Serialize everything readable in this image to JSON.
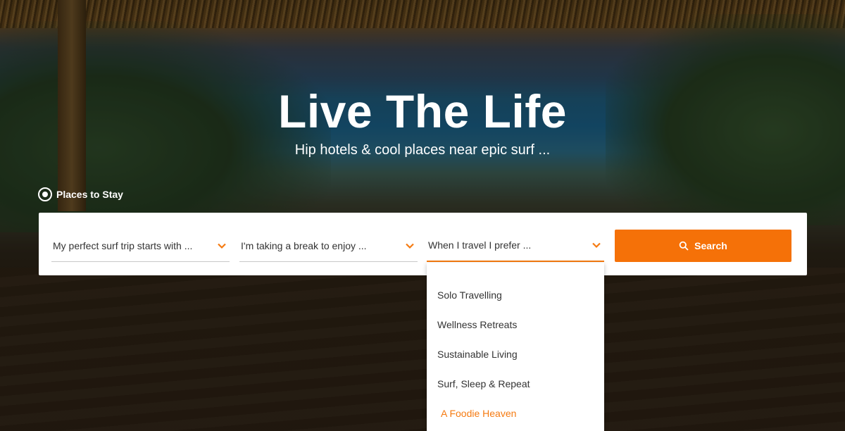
{
  "hero": {
    "headline": "Live The Life",
    "subline": "Hip hotels & cool places near epic surf ..."
  },
  "tab": {
    "label": "Places to Stay",
    "icon": "radio-selected-icon"
  },
  "search": {
    "selects": [
      {
        "label": "My perfect surf trip starts with ...",
        "icon": "chevron-down-icon"
      },
      {
        "label": "I'm taking a break to enjoy ...",
        "icon": "chevron-down-icon"
      },
      {
        "label": "When I travel I prefer ...",
        "icon": "chevron-down-icon"
      }
    ],
    "button_label": "Search",
    "button_icon": "search-icon"
  },
  "dropdown": {
    "options": [
      "Solo Travelling",
      "Wellness Retreats",
      "Sustainable Living",
      "Surf, Sleep & Repeat",
      "A Foodie Heaven"
    ]
  },
  "colors": {
    "accent": "#f57108",
    "text": "#333333",
    "white": "#ffffff"
  }
}
